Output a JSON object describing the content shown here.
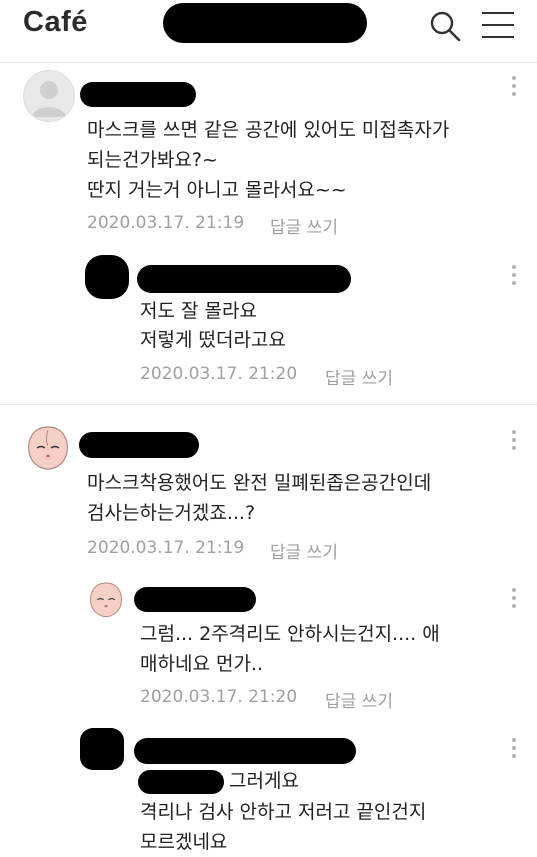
{
  "app": {
    "logo_text": "Café"
  },
  "header": {
    "search_icon": "search-icon",
    "menu_icon": "hamburger-menu-icon"
  },
  "comments": [
    {
      "lines": [
        "마스크를 쓰면 같은 공간에 있어도 미접촉자가",
        "되는건가봐요?~",
        "딴지 거는거 아니고 몰라서요~~"
      ],
      "timestamp": "2020.03.17. 21:19",
      "reply_label": "답글 쓰기"
    },
    {
      "lines": [
        "저도 잘 몰라요",
        "저렇게 떴더라고요"
      ],
      "timestamp": "2020.03.17. 21:20",
      "reply_label": "답글 쓰기"
    },
    {
      "lines": [
        "마스크착용했어도 완전 밀폐된좁은공간인데",
        "검사는하는거겠죠...?"
      ],
      "timestamp": "2020.03.17. 21:19",
      "reply_label": "답글 쓰기"
    },
    {
      "lines": [
        "그럼... 2주격리도 안하시는건지.... 애",
        "매하네요 먼가.."
      ],
      "timestamp": "2020.03.17. 21:20",
      "reply_label": "답글 쓰기"
    },
    {
      "lines": [
        "그러게요",
        "격리나 검사 안하고 저러고 끝인건지",
        "모르겠네요"
      ]
    }
  ]
}
